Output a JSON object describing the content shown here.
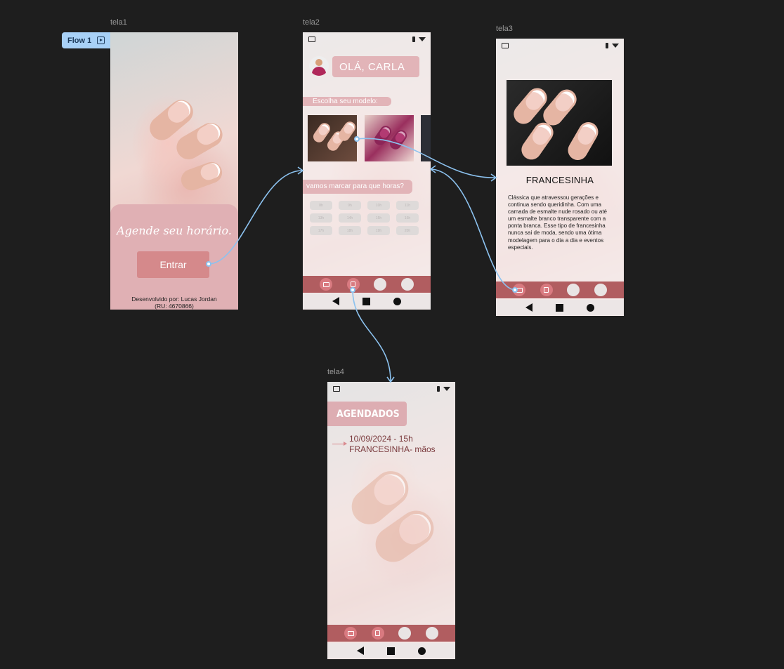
{
  "canvas": {
    "background": "#1e1e1e"
  },
  "flow": {
    "label": "Flow 1",
    "icon": "flow-play-icon"
  },
  "frames": {
    "tela1": {
      "name": "tela1",
      "title": "Agende seu horário.",
      "button": "Entrar",
      "credit_line1": "Desenvolvido por: Lucas Jordan",
      "credit_line2": "(RU: 4670866)"
    },
    "tela2": {
      "name": "tela2",
      "greeting": "OLÁ, CARLA",
      "choose_label": "Escolha seu modelo:",
      "time_question": "vamos marcar para que horas?",
      "time_slots": [
        "8h",
        "9h",
        "10h",
        "11h",
        "13h",
        "14h",
        "15h",
        "16h",
        "17h",
        "18h",
        "19h",
        "20h"
      ]
    },
    "tela3": {
      "name": "tela3",
      "title": "FRANCESINHA",
      "description": "Clássica que atravessou gerações e continua sendo queridinha. Com uma camada de esmalte nude rosado ou até um esmalte branco transparente com a ponta branca. Esse tipo de francesinha nunca sai de moda, sendo uma ótima modelagem para o dia a dia e eventos especiais."
    },
    "tela4": {
      "name": "tela4",
      "header": "AGENDADOS",
      "appointment_line1": "10/09/2024 - 15h",
      "appointment_line2": "FRANCESINHA- mãos"
    }
  },
  "colors": {
    "accent_pink": "#e2b4b8",
    "tab_bar": "#b15d60",
    "button": "#d5898b",
    "connector": "#8cc2ef"
  },
  "icons": {
    "status": [
      "message-icon",
      "battery-icon",
      "wifi-icon"
    ],
    "tabs": [
      "catalog-icon",
      "calendar-icon",
      "empty-tab",
      "empty-tab"
    ],
    "system_nav": [
      "back-icon",
      "home-icon",
      "recent-icon"
    ]
  }
}
